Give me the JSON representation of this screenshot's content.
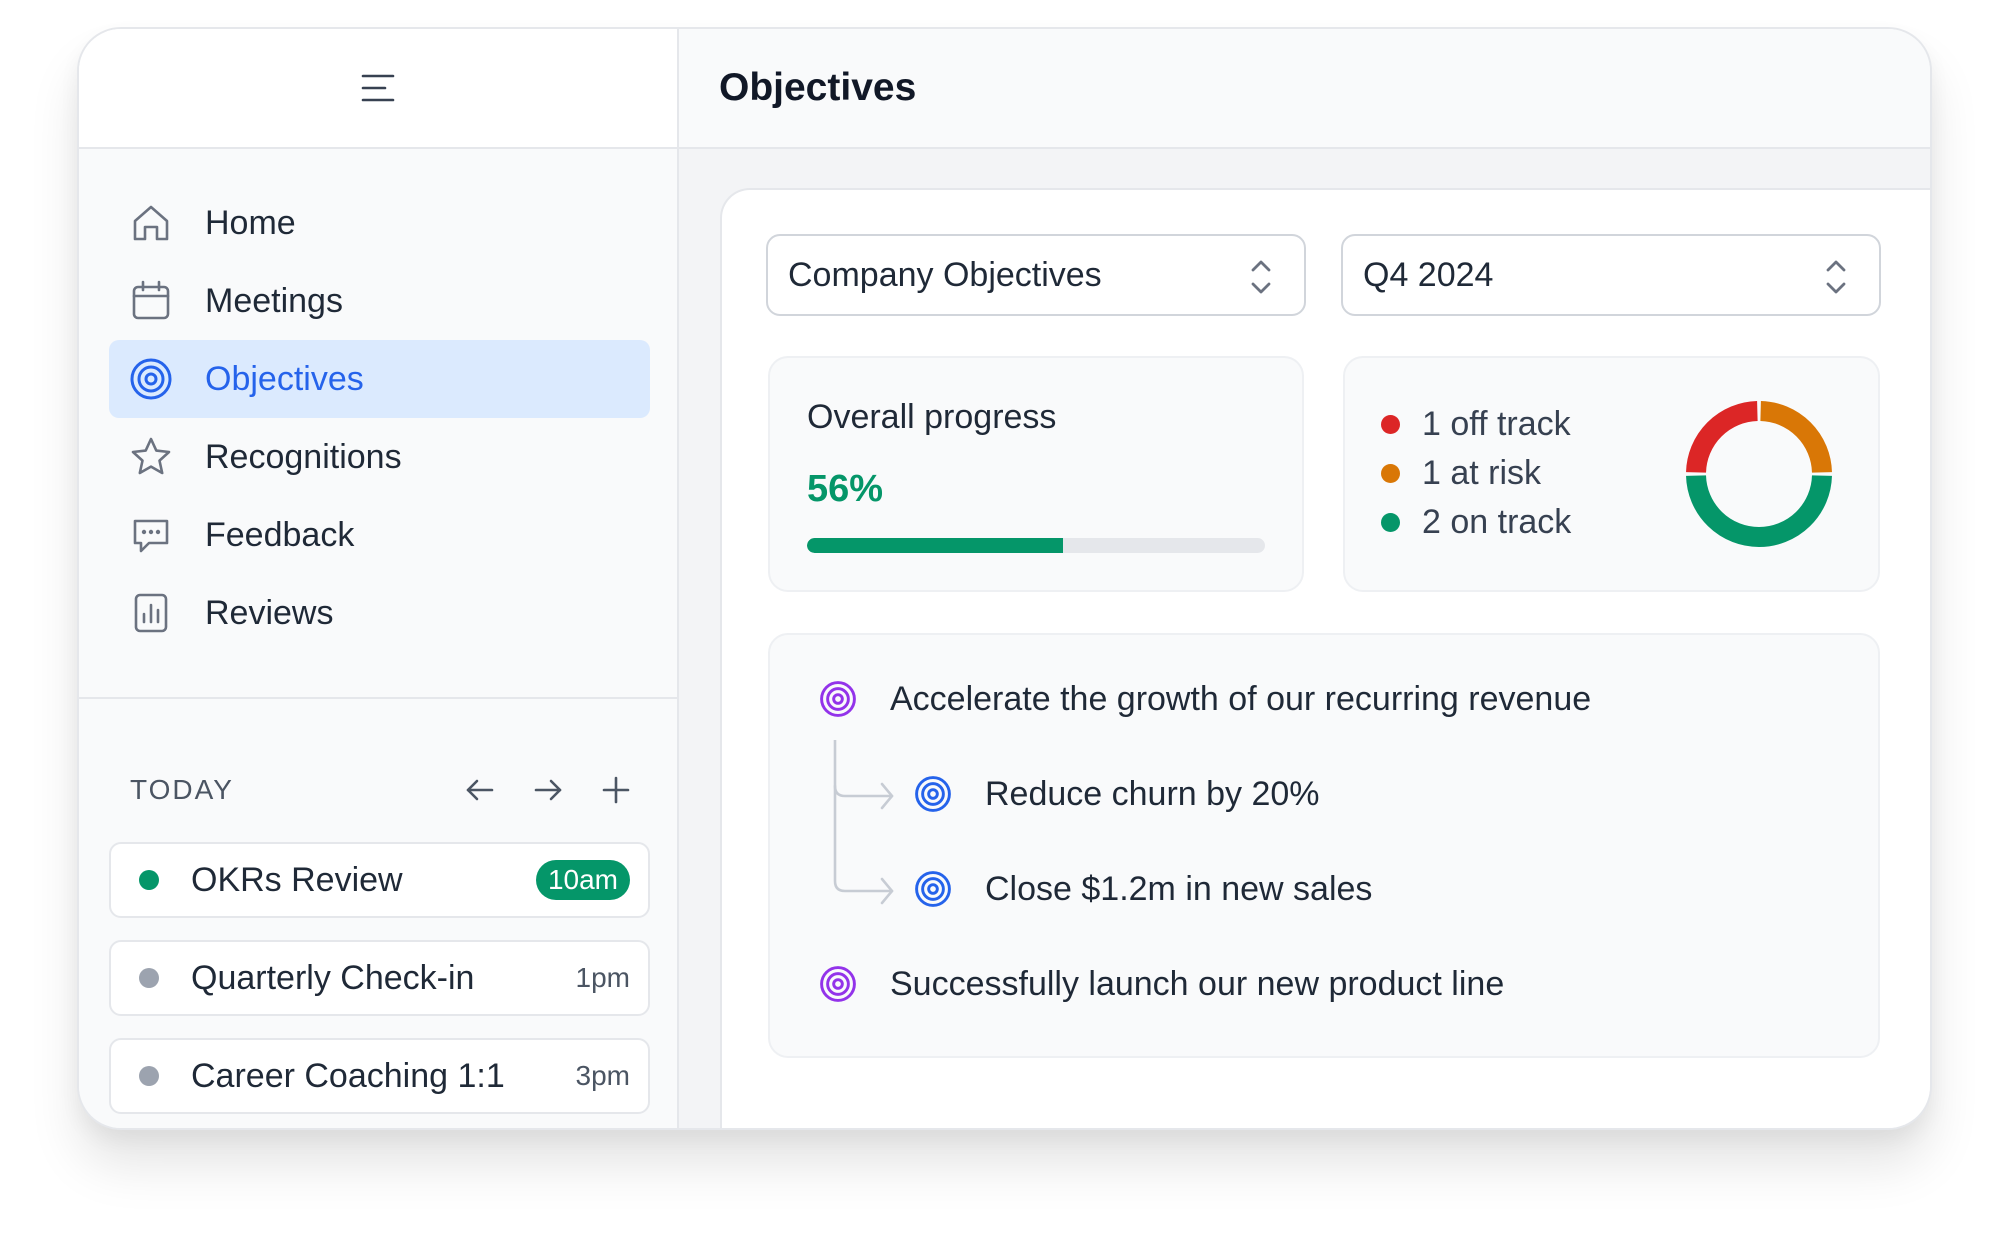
{
  "header": {
    "title": "Objectives"
  },
  "sidebar": {
    "items": [
      {
        "label": "Home",
        "icon": "home-icon"
      },
      {
        "label": "Meetings",
        "icon": "calendar-icon"
      },
      {
        "label": "Objectives",
        "icon": "target-icon",
        "active": true
      },
      {
        "label": "Recognitions",
        "icon": "star-icon"
      },
      {
        "label": "Feedback",
        "icon": "chat-icon"
      },
      {
        "label": "Reviews",
        "icon": "chart-icon"
      }
    ],
    "today": {
      "label": "TODAY",
      "meetings": [
        {
          "title": "OKRs Review",
          "time": "10am",
          "status_color": "#059669",
          "highlighted": true
        },
        {
          "title": "Quarterly Check-in",
          "time": "1pm",
          "status_color": "#9ca3af"
        },
        {
          "title": "Career Coaching 1:1",
          "time": "3pm",
          "status_color": "#9ca3af"
        }
      ]
    }
  },
  "filters": {
    "scope": "Company Objectives",
    "period": "Q4 2024"
  },
  "progress": {
    "label": "Overall progress",
    "value_text": "56%",
    "value": 0.56
  },
  "status_summary": {
    "items": [
      {
        "label": "1 off track",
        "color": "#dc2626",
        "count": 1
      },
      {
        "label": "1 at risk",
        "color": "#d97706",
        "count": 1
      },
      {
        "label": "2 on track",
        "color": "#059669",
        "count": 2
      }
    ]
  },
  "objectives": [
    {
      "title": "Accelerate the growth of our recurring revenue",
      "color": "#9333ea",
      "key_results": [
        {
          "title": "Reduce churn by 20%",
          "color": "#2563eb"
        },
        {
          "title": "Close $1.2m in new sales",
          "color": "#2563eb"
        }
      ]
    },
    {
      "title": "Successfully launch our new product line",
      "color": "#9333ea",
      "key_results": []
    }
  ],
  "colors": {
    "accent": "#2563eb",
    "success": "#059669",
    "warning": "#d97706",
    "danger": "#dc2626",
    "objective": "#9333ea"
  }
}
